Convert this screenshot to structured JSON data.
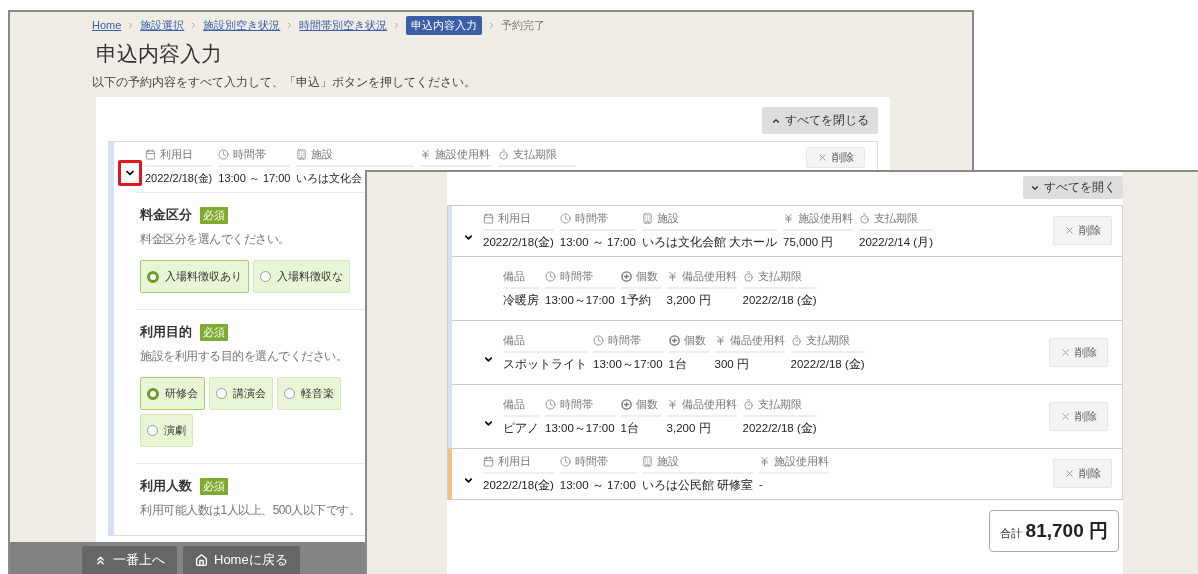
{
  "back_window": {
    "breadcrumb": [
      {
        "label": "Home",
        "kind": "link"
      },
      {
        "label": "施設選択",
        "kind": "link"
      },
      {
        "label": "施設別空き状況",
        "kind": "link"
      },
      {
        "label": "時間帯別空き状況",
        "kind": "link"
      },
      {
        "label": "申込内容入力",
        "kind": "current"
      },
      {
        "label": "予約完了",
        "kind": "plain"
      }
    ],
    "title": "申込内容入力",
    "description": "以下の予約内容をすべて入力して、「申込」ボタンを押してください。",
    "toggle_all_button": {
      "label": "すべてを閉じる",
      "kind": "collapse"
    },
    "reservation": {
      "highlighted": true,
      "color": "#d5e2f5",
      "delete": "削除",
      "fields": [
        {
          "kind": "date",
          "label": "利用日",
          "value": "2022/2/18(金)"
        },
        {
          "kind": "time",
          "label": "時間帯",
          "value": "13:00 ～ 17:00"
        },
        {
          "kind": "facility",
          "label": "施設",
          "value": "いろは文化会"
        },
        {
          "kind": "fee",
          "label": "施設使用料"
        },
        {
          "kind": "deadline",
          "label": "支払期限"
        }
      ]
    },
    "sections": [
      {
        "title": "料金区分",
        "badge": "必須",
        "hint": "料金区分を選んでください。",
        "options": [
          {
            "label": "入場料徴収あり",
            "selected": true
          },
          {
            "label": "入場料徴収な",
            "selected": false
          }
        ]
      },
      {
        "title": "利用目的",
        "badge": "必須",
        "hint": "施設を利用する目的を選んでください。",
        "options": [
          {
            "label": "研修会",
            "selected": true
          },
          {
            "label": "講演会",
            "selected": false
          },
          {
            "label": "軽音楽",
            "selected": false
          },
          {
            "label": "演劇",
            "selected": false
          }
        ]
      },
      {
        "title": "利用人数",
        "badge": "必須",
        "hint": "利用可能人数は1人以上、500人以下です。"
      }
    ],
    "footer_buttons": [
      {
        "label": "一番上へ",
        "kind": "top"
      },
      {
        "label": "Homeに戻る",
        "kind": "home"
      }
    ]
  },
  "front_window": {
    "toggle_all_button": {
      "label": "すべてを開く",
      "kind": "expand"
    },
    "items": [
      {
        "color": "#d5e2f5",
        "chevron": true,
        "delete": "削除",
        "fields": [
          {
            "kind": "date",
            "label": "利用日",
            "value": "2022/2/18(金)"
          },
          {
            "kind": "time",
            "label": "時間帯",
            "value": "13:00 ～ 17:00"
          },
          {
            "kind": "facility",
            "label": "施設",
            "value": "いろは文化会館 大ホール"
          },
          {
            "kind": "fee",
            "label": "施設使用料",
            "value": "75,000 円"
          },
          {
            "kind": "deadline",
            "label": "支払期限",
            "value": "2022/2/14 (月)"
          }
        ],
        "children": [
          {
            "chevron": false,
            "fields": [
              {
                "kind": "item",
                "label": "備品",
                "value": "冷暖房"
              },
              {
                "kind": "time",
                "label": "時間帯",
                "value": "13:00～17:00"
              },
              {
                "kind": "count",
                "label": "個数",
                "value": "1予約"
              },
              {
                "kind": "fee",
                "label": "備品使用料",
                "value": "3,200 円"
              },
              {
                "kind": "deadline",
                "label": "支払期限",
                "value": "2022/2/18 (金)"
              }
            ]
          },
          {
            "chevron": true,
            "delete": "削除",
            "fields": [
              {
                "kind": "item",
                "label": "備品",
                "value": "スポットライト"
              },
              {
                "kind": "time",
                "label": "時間帯",
                "value": "13:00～17:00"
              },
              {
                "kind": "count",
                "label": "個数",
                "value": "1台"
              },
              {
                "kind": "fee",
                "label": "備品使用料",
                "value": "300 円"
              },
              {
                "kind": "deadline",
                "label": "支払期限",
                "value": "2022/2/18 (金)"
              }
            ]
          },
          {
            "chevron": true,
            "delete": "削除",
            "fields": [
              {
                "kind": "item",
                "label": "備品",
                "value": "ピアノ"
              },
              {
                "kind": "time",
                "label": "時間帯",
                "value": "13:00～17:00"
              },
              {
                "kind": "count",
                "label": "個数",
                "value": "1台"
              },
              {
                "kind": "fee",
                "label": "備品使用料",
                "value": "3,200 円"
              },
              {
                "kind": "deadline",
                "label": "支払期限",
                "value": "2022/2/18 (金)"
              }
            ]
          }
        ]
      },
      {
        "color": "#f3c27c",
        "chevron": true,
        "delete": "削除",
        "fields": [
          {
            "kind": "date",
            "label": "利用日",
            "value": "2022/2/18(金)"
          },
          {
            "kind": "time",
            "label": "時間帯",
            "value": "13:00 ～ 17:00"
          },
          {
            "kind": "facility",
            "label": "施設",
            "value": "いろは公民館 研修室"
          },
          {
            "kind": "fee",
            "label": "施設使用料",
            "value": "-"
          }
        ]
      }
    ],
    "total": {
      "label": "合計",
      "value": "81,700 円"
    }
  }
}
